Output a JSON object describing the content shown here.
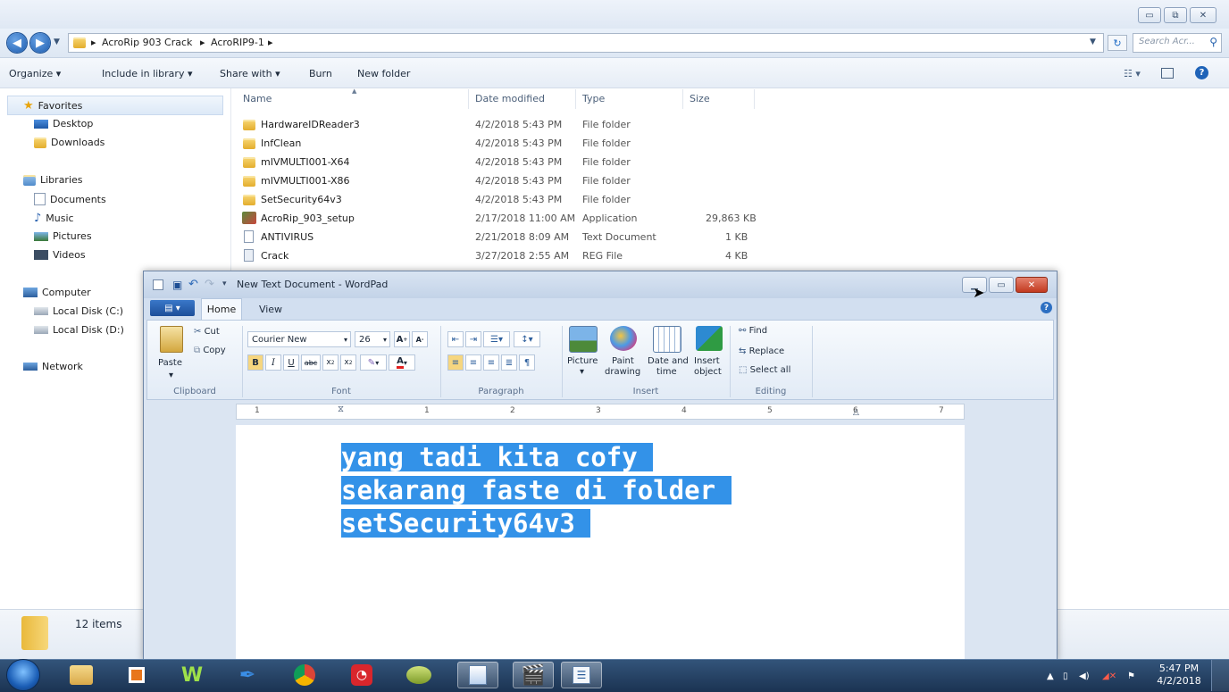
{
  "explorer": {
    "breadcrumb": [
      "AcroRip 903 Crack",
      "AcroRIP9-1"
    ],
    "search_placeholder": "Search Acr...",
    "toolbar": {
      "organize": "Organize ▾",
      "include_in_library": "Include in library ▾",
      "share_with": "Share with ▾",
      "burn": "Burn",
      "new_folder": "New folder"
    },
    "nav": {
      "favorites": "Favorites",
      "desktop": "Desktop",
      "downloads": "Downloads",
      "libraries": "Libraries",
      "documents": "Documents",
      "music": "Music",
      "pictures": "Pictures",
      "videos": "Videos",
      "computer": "Computer",
      "local_c": "Local Disk (C:)",
      "local_d": "Local Disk (D:)",
      "network": "Network"
    },
    "columns": {
      "name": "Name",
      "date": "Date modified",
      "type": "Type",
      "size": "Size"
    },
    "files": [
      {
        "name": "HardwareIDReader3",
        "date": "4/2/2018 5:43 PM",
        "type": "File folder",
        "size": ""
      },
      {
        "name": "InfClean",
        "date": "4/2/2018 5:43 PM",
        "type": "File folder",
        "size": ""
      },
      {
        "name": "mIVMULTI001-X64",
        "date": "4/2/2018 5:43 PM",
        "type": "File folder",
        "size": ""
      },
      {
        "name": "mIVMULTI001-X86",
        "date": "4/2/2018 5:43 PM",
        "type": "File folder",
        "size": ""
      },
      {
        "name": "SetSecurity64v3",
        "date": "4/2/2018 5:43 PM",
        "type": "File folder",
        "size": ""
      },
      {
        "name": "AcroRip_903_setup",
        "date": "2/17/2018 11:00 AM",
        "type": "Application",
        "size": "29,863 KB"
      },
      {
        "name": "ANTIVIRUS",
        "date": "2/21/2018 8:09 AM",
        "type": "Text Document",
        "size": "1 KB"
      },
      {
        "name": "Crack",
        "date": "3/27/2018 2:55 AM",
        "type": "REG File",
        "size": "4 KB"
      }
    ],
    "status": "12 items"
  },
  "wordpad": {
    "title": "New Text Document - WordPad",
    "tabs": {
      "home": "Home",
      "view": "View"
    },
    "clipboard": {
      "paste": "Paste",
      "cut": "Cut",
      "copy": "Copy",
      "group": "Clipboard"
    },
    "font": {
      "family": "Courier New",
      "size": "26",
      "group": "Font"
    },
    "paragraph": {
      "group": "Paragraph"
    },
    "insert": {
      "picture": "Picture",
      "paint": "Paint",
      "paint2": "drawing",
      "datetime": "Date and",
      "datetime2": "time",
      "object": "Insert",
      "object2": "object",
      "group": "Insert"
    },
    "editing": {
      "find": "Find",
      "replace": "Replace",
      "select_all": "Select all",
      "group": "Editing"
    },
    "ruler": [
      "1",
      "1",
      "2",
      "3",
      "4",
      "5",
      "6",
      "7"
    ],
    "document_lines": [
      "yang tadi kita cofy ",
      "sekarang faste di folder ",
      "setSecurity64v3 "
    ]
  },
  "taskbar": {
    "time": "5:47 PM",
    "date": "4/2/2018"
  }
}
